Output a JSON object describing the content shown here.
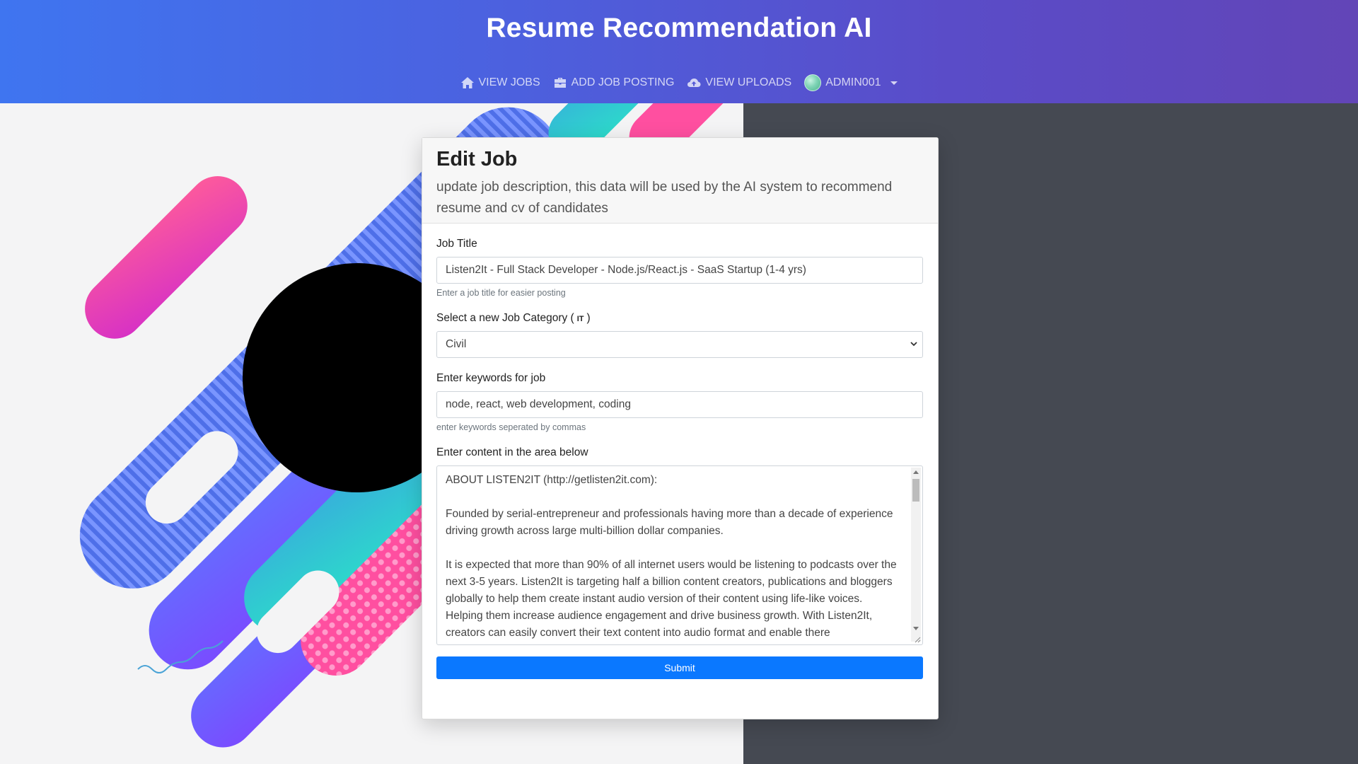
{
  "header": {
    "title": "Resume Recommendation AI",
    "nav": [
      {
        "label": "VIEW JOBS",
        "icon": "home-icon"
      },
      {
        "label": "ADD JOB POSTING",
        "icon": "briefcase-icon"
      },
      {
        "label": "VIEW UPLOADS",
        "icon": "cloud-upload-icon"
      },
      {
        "label": "ADMIN001",
        "icon": "avatar"
      }
    ]
  },
  "card": {
    "title": "Edit Job",
    "subtitle": "update job description, this data will be used by the AI system to recommend resume and cv of candidates",
    "job_title": {
      "label": "Job Title",
      "value": "Listen2It - Full Stack Developer - Node.js/React.js - SaaS Startup (1-4 yrs)",
      "help": "Enter a job title for easier posting"
    },
    "category": {
      "label_prefix": "Select a new Job Category (",
      "current": "IT",
      "label_suffix": ")",
      "selected": "Civil"
    },
    "keywords": {
      "label": "Enter keywords for job",
      "value": "node, react, web development, coding",
      "help": "enter keywords seperated by commas"
    },
    "content": {
      "label": "Enter content in the area below",
      "paragraphs": [
        "ABOUT LISTEN2IT (http://getlisten2it.com):",
        "Founded by serial-entrepreneur and professionals having more than a decade of experience driving growth across large multi-billion dollar companies.",
        "It is expected that more than 90% of all internet users would be listening to podcasts over the next 3-5 years. Listen2It is targeting half a billion content creators, publications and bloggers globally to help them create instant audio version of their content using life-like voices. Helping them increase audience engagement and drive business growth. With Listen2It, creators can easily convert their text content into audio format and enable there"
      ]
    },
    "submit_label": "Submit"
  },
  "colors": {
    "header_start": "#3f75f0",
    "header_end": "#6245b7",
    "primary_button": "#0a78ff",
    "page_background": "#454952"
  }
}
